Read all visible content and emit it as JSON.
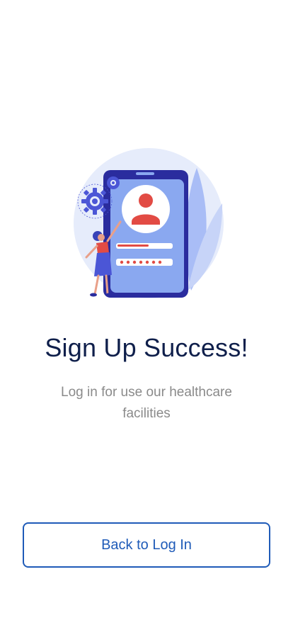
{
  "success": {
    "title": "Sign Up Success!",
    "subtitle": "Log in for use our healthcare facilities",
    "back_button_label": "Back to Log In"
  },
  "illustration": {
    "icon": "phone-signup-illustration",
    "colors": {
      "circle": "#e6ecfb",
      "phone": "#2a2c9e",
      "screen": "#8aa8f0",
      "avatar": "#e24b44",
      "leaf": "#a9bdf6",
      "gear": "#4b56d6"
    }
  },
  "colors": {
    "title": "#0f1f4b",
    "subtitle": "#8a8a8a",
    "accent": "#1f5bb8",
    "background": "#ffffff"
  }
}
